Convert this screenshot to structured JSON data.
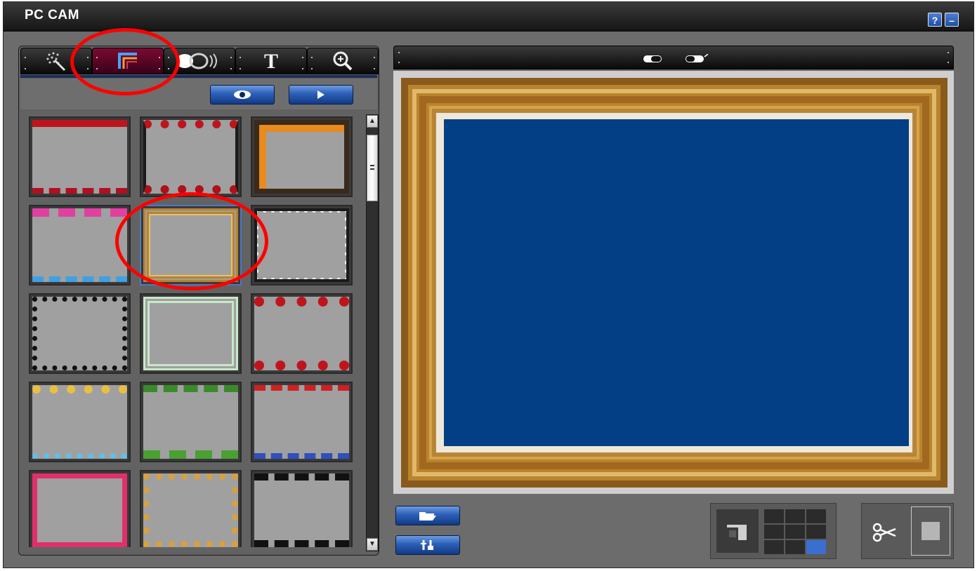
{
  "window": {
    "title": "PC CAM",
    "help_label": "?",
    "minimize_label": "–"
  },
  "left_panel": {
    "tabs": [
      {
        "name": "tab-effects",
        "icon": "sparkle-wand-icon",
        "active": false
      },
      {
        "name": "tab-frames",
        "icon": "frame-corner-icon",
        "active": true
      },
      {
        "name": "tab-stamps",
        "icon": "stamp-toggle-icon",
        "active": false
      },
      {
        "name": "tab-text",
        "icon": "text-icon",
        "active": false
      },
      {
        "name": "tab-zoom",
        "icon": "zoom-in-icon",
        "active": false
      }
    ],
    "tab_text_label": "T",
    "actions": [
      {
        "name": "preview-button",
        "icon": "eye-icon"
      },
      {
        "name": "apply-button",
        "icon": "play-icon"
      }
    ],
    "thumbnails": [
      {
        "style": "red-leaves-corners"
      },
      {
        "style": "red-flowers-top-bottom"
      },
      {
        "style": "orange-leaves-corners"
      },
      {
        "style": "rainbow-pencils"
      },
      {
        "style": "gold-ornate",
        "selected": true
      },
      {
        "style": "white-stamp-edge"
      },
      {
        "style": "black-film-edge"
      },
      {
        "style": "green-white-border"
      },
      {
        "style": "red-roses"
      },
      {
        "style": "balloons"
      },
      {
        "style": "green-vines"
      },
      {
        "style": "festive-candles"
      },
      {
        "style": "pink-birthday"
      },
      {
        "style": "confetti-border"
      },
      {
        "style": "film-strip"
      }
    ]
  },
  "right_panel": {
    "header_icons": [
      "toggle-off-icon",
      "toggle-on-icon"
    ],
    "picture_color": "#033f85"
  },
  "bottom": {
    "buttons": [
      {
        "name": "open-folder-button",
        "icon": "folder-open-icon"
      },
      {
        "name": "settings-button",
        "icon": "tools-icon"
      }
    ],
    "layout_grid": {
      "rows": 3,
      "cols": 3,
      "selected_index": 8
    },
    "cut_icon": "scissors-icon"
  },
  "annotations": {
    "color": "#ff0000"
  }
}
